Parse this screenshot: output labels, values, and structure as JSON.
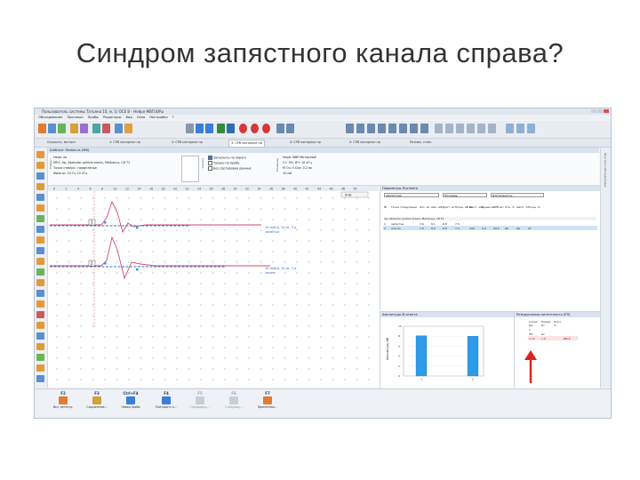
{
  "slide": {
    "title": "Синдром запястного канала справа?"
  },
  "window": {
    "title": "Пользователь системы Татьяна 10, м, 1/ ОСЕ В - Нейро-МВП.8/Ru",
    "menu": [
      "Обследование",
      "Протокол",
      "Пробы",
      "Редакторы",
      "Вид",
      "Окно",
      "Настройки",
      "?"
    ]
  },
  "tabs": [
    "Скорость, моторн",
    "1: СРВ моторное пр",
    "2: СРВ моторное пр",
    "3: СРВ моторное пр",
    "4: СРВ моторное пр",
    "5: СРВ моторное пр",
    "Ритмич. стим."
  ],
  "patient_section": {
    "header": "Шаблон: Medianus (МВ)",
    "vertical_labels": [
      "Клиент",
      "Анализ",
      "Усиление"
    ],
    "lines": [
      "Нерв: лв",
      "МП1, пр, Abductor pollicis brevis, Medianus, С8 Т1",
      "Точка стимул.: предплечье",
      "Фильтр: 10 Гц 10 кГц"
    ],
    "options": [
      "Запускать по порогу",
      "Только по пробу",
      "Без сортировки данных"
    ],
    "right_lines": [
      "Нерв: ФВР Моторный",
      "Ст: 5%, ВЧ: 10 кГц",
      "М Оч: 5 Dur: 0,2 мс",
      "10 мА"
    ]
  },
  "waveform": {
    "time_ticks": [
      "0",
      "2",
      "4",
      "6",
      "8",
      "10",
      "12",
      "14",
      "16",
      "18",
      "20",
      "22",
      "24",
      "26",
      "28",
      "30",
      "32",
      "34",
      "36",
      "38",
      "40",
      "42",
      "44",
      "46",
      "48",
      "50"
    ],
    "scale": "4 мс",
    "traces": [
      {
        "id": "1",
        "note": "10 мкВ/д, 10 мс, 3 д",
        "sub": "запястье"
      },
      {
        "id": "2",
        "note": "10 мкВ/д, 10 мс, 3 д",
        "sub": "локоть"
      }
    ]
  },
  "params": {
    "header": "Параметры М-ответа",
    "toolbar": [
      "Амплитуда",
      "Площадь",
      "Длительность"
    ],
    "columns": [
      "№",
      "Точка стимуляции",
      "Лат. мс",
      "Амп. мВ",
      "Длит. мс",
      "Площ. мВ·мс",
      "Расст. мм",
      "Время мс",
      "СРВ м/с",
      "Отн. %",
      "Ампл. %",
      "Площ. %"
    ],
    "group": "пр, Abductor pollicis brevis, Medianus, С8 Т1",
    "rows": [
      [
        "1",
        "запястье",
        "3.6",
        "8.1",
        "6.8",
        "7.5",
        "",
        "",
        "",
        "",
        "",
        ""
      ],
      [
        "2",
        "локоть",
        "7.9",
        "8.0",
        "6.6",
        "7.3",
        "230",
        "4.3",
        "53.5",
        "90",
        "99",
        "97"
      ]
    ]
  },
  "amp_chart": {
    "header": "Амплитуда М-ответа",
    "ylabel": "Амплитуда, мВ",
    "y_ticks": [
      "0",
      "2",
      "4",
      "6",
      "8",
      "10"
    ],
    "categories": [
      "1",
      "2"
    ]
  },
  "dist": {
    "header": "Резидуальная латентность (РЛ)",
    "columns": [
      "Точка",
      "Норма",
      "Откл."
    ],
    "units": [
      "мм",
      "мс",
      "%"
    ],
    "rows": [
      [
        "1",
        "",
        ""
      ],
      [
        "РЛ",
        "мс",
        ""
      ]
    ],
    "value_row": [
      "3.34",
      "1.8",
      "-85.4"
    ]
  },
  "fkeys": [
    {
      "key": "F2",
      "label": "Вкл. регистр."
    },
    {
      "key": "F3",
      "label": "Сохранение..."
    },
    {
      "key": "Ctrl+F4",
      "label": "Новая проба"
    },
    {
      "key": "F4",
      "label": "Повторить п..."
    },
    {
      "key": "F5",
      "label": "Предыдущ..."
    },
    {
      "key": "F6",
      "label": "Следующ..."
    },
    {
      "key": "F7",
      "label": "Временная..."
    }
  ],
  "side_panel": "Протокол обследования",
  "chart_data": {
    "type": "bar",
    "categories": [
      "1",
      "2"
    ],
    "values": [
      8.1,
      8.0
    ],
    "ylabel": "Амплитуда, мВ",
    "ylim": [
      0,
      10
    ]
  },
  "colors": {
    "bar": "#2f9ae8",
    "wave_red": "#d24a6a",
    "wave_blue": "#3a6fc4",
    "header": "#d8e3ef"
  }
}
